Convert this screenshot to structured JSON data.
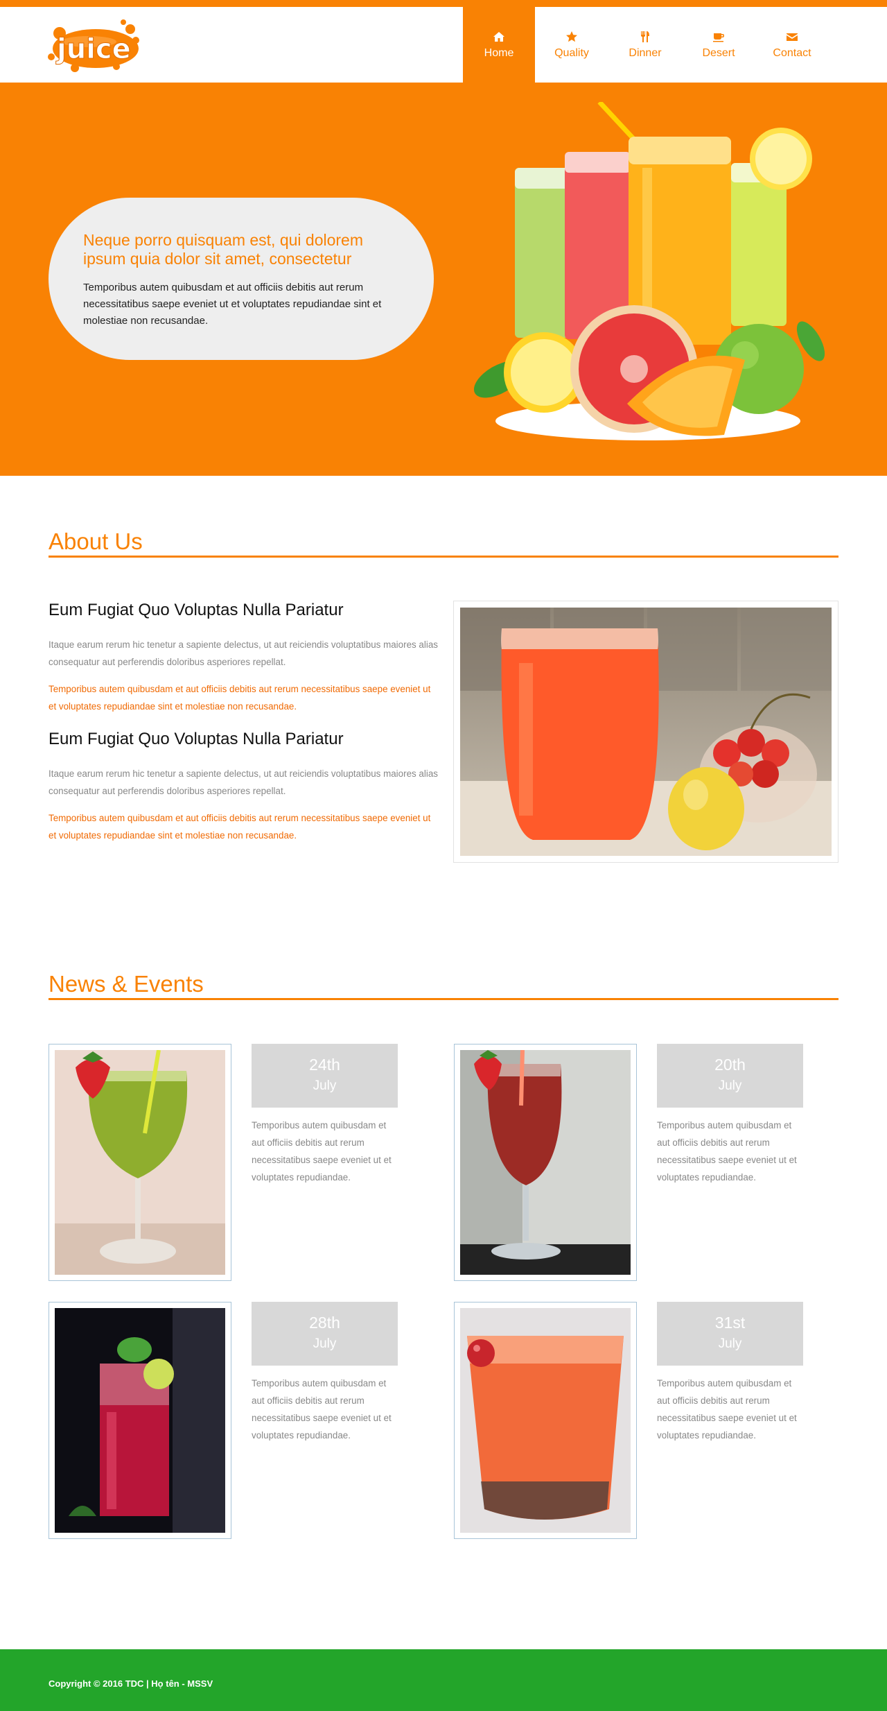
{
  "brand": {
    "logo_text": "juice",
    "accent": "#f98204",
    "footer_color": "#23a52a"
  },
  "nav": {
    "items": [
      {
        "label": "Home",
        "icon": "home-icon",
        "active": true
      },
      {
        "label": "Quality",
        "icon": "star-icon",
        "active": false
      },
      {
        "label": "Dinner",
        "icon": "cutlery-icon",
        "active": false
      },
      {
        "label": "Desert",
        "icon": "coffee-cup-icon",
        "active": false
      },
      {
        "label": "Contact",
        "icon": "envelope-icon",
        "active": false
      }
    ]
  },
  "hero": {
    "title": "Neque porro quisquam est, qui dolorem ipsum quia dolor sit amet, consectetur",
    "text": "Temporibus autem quibusdam et aut officiis debitis aut rerum necessitatibus saepe eveniet ut et voluptates repudiandae sint et molestiae non recusandae."
  },
  "about": {
    "title": "About Us",
    "blocks": [
      {
        "heading": "Eum Fugiat Quo Voluptas Nulla Pariatur",
        "text": "Itaque earum rerum hic tenetur a sapiente delectus, ut aut reiciendis voluptatibus maiores alias consequatur aut perferendis doloribus asperiores repellat.",
        "highlight": "Temporibus autem quibusdam et aut officiis debitis aut rerum necessitatibus saepe eveniet ut et voluptates repudiandae sint et molestiae non recusandae."
      },
      {
        "heading": "Eum Fugiat Quo Voluptas Nulla Pariatur",
        "text": "Itaque earum rerum hic tenetur a sapiente delectus, ut aut reiciendis voluptatibus maiores alias consequatur aut perferendis doloribus asperiores repellat.",
        "highlight": "Temporibus autem quibusdam et aut officiis debitis aut rerum necessitatibus saepe eveniet ut et voluptates repudiandae sint et molestiae non recusandae."
      }
    ]
  },
  "news": {
    "title": "News & Events",
    "items": [
      {
        "day": "24th",
        "month": "July",
        "text": "Temporibus autem quibusdam et aut officiis debitis aut rerum necessitatibus saepe eveniet ut et voluptates repudiandae."
      },
      {
        "day": "20th",
        "month": "July",
        "text": "Temporibus autem quibusdam et aut officiis debitis aut rerum necessitatibus saepe eveniet ut et voluptates repudiandae."
      },
      {
        "day": "28th",
        "month": "July",
        "text": "Temporibus autem quibusdam et aut officiis debitis aut rerum necessitatibus saepe eveniet ut et voluptates repudiandae."
      },
      {
        "day": "31st",
        "month": "July",
        "text": "Temporibus autem quibusdam et aut officiis debitis aut rerum necessitatibus saepe eveniet ut et voluptates repudiandae."
      }
    ]
  },
  "footer": {
    "text": "Copyright © 2016 TDC | Họ tên - MSSV"
  }
}
